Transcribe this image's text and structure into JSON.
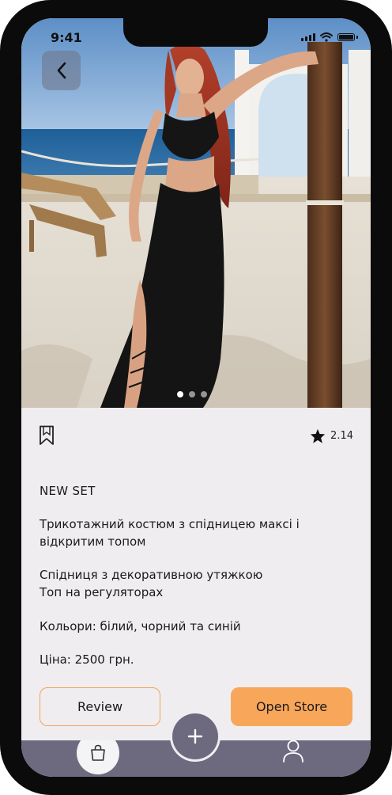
{
  "status": {
    "time": "9:41"
  },
  "product": {
    "title": "NEW SET",
    "description_1": "Трикотажний костюм з спідницею максі і відкритим топом",
    "description_2": "Спідниця з декоративною утяжкою\nТоп на регуляторах",
    "colors_line": "Кольори: білий, чорний та синій",
    "price_line": "Ціна: 2500 грн.",
    "rating": "2.14",
    "images_count": 3,
    "active_image_index": 0
  },
  "actions": {
    "review_label": "Review",
    "open_store_label": "Open Store"
  },
  "icons": {
    "back": "chevron-left-icon",
    "bookmark": "bookmark-icon",
    "star": "star-icon",
    "shop": "shopping-bag-icon",
    "add": "plus-icon",
    "profile": "user-icon"
  },
  "colors": {
    "accent": "#f7a65a",
    "nav": "#6d6a80",
    "card_bg": "#efedf0"
  }
}
